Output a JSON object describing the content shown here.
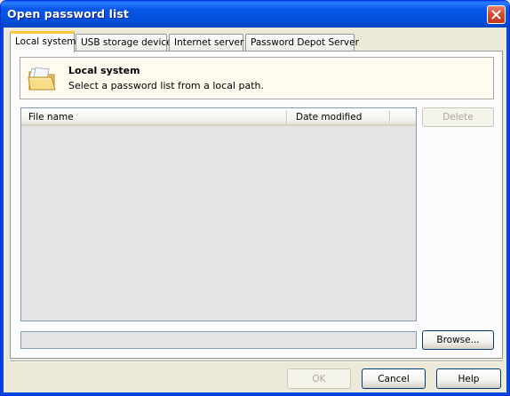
{
  "window": {
    "title": "Open password list"
  },
  "tabs": [
    {
      "label": "Local system",
      "active": true
    },
    {
      "label": "USB storage device",
      "active": false
    },
    {
      "label": "Internet server",
      "active": false
    },
    {
      "label": "Password Depot Server",
      "active": false
    }
  ],
  "header": {
    "title": "Local system",
    "description": "Select a password list from a local path.",
    "icon": "folder-icon"
  },
  "list": {
    "columns": [
      "File name",
      "Date modified"
    ],
    "rows": []
  },
  "buttons": {
    "delete": "Delete",
    "browse": "Browse...",
    "ok": "OK",
    "cancel": "Cancel",
    "help": "Help"
  },
  "path": {
    "value": ""
  },
  "colors": {
    "titlebar": "#0450de",
    "tab_highlight": "#ffc83c",
    "panel_bg": "#fcfcfe",
    "dialog_bg": "#ece9d8",
    "header_bg": "#fffbef"
  }
}
